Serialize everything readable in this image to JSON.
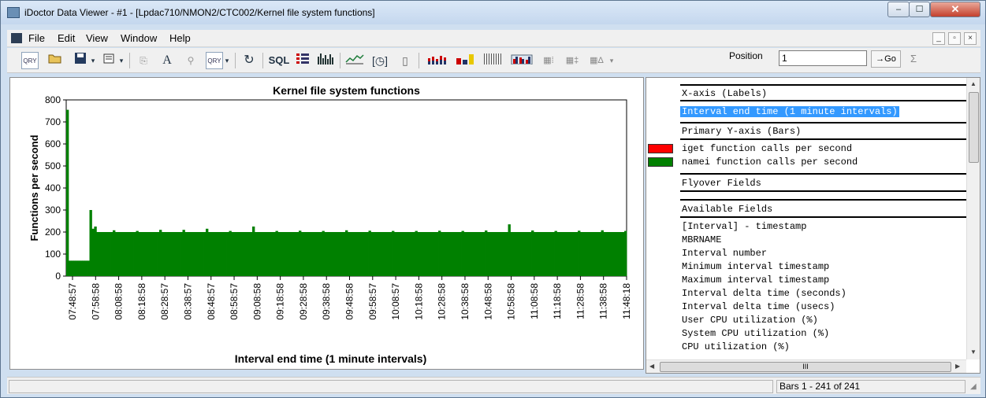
{
  "window": {
    "title": "iDoctor Data Viewer - #1 - [Lpdac710/NMON2/CTC002/Kernel file system functions]",
    "controls": {
      "minimize": "–",
      "maximize": "☐",
      "close": "✕"
    }
  },
  "menu": {
    "items": [
      "File",
      "Edit",
      "View",
      "Window",
      "Help"
    ],
    "mdi_controls": [
      "_",
      "▫",
      "×"
    ]
  },
  "toolbar": {
    "sql_label": "SQL",
    "position_label": "Position",
    "position_value": "1",
    "go_label": "→Go",
    "sum_label": "Σ",
    "icons": [
      "query-icon",
      "open-icon",
      "save-icon",
      "properties-icon",
      "copy-icon",
      "font-icon",
      "filter-icon",
      "query2-icon",
      "refresh-icon",
      "sql-icon",
      "list-icon",
      "bar-chart-icon",
      "line-chart-icon",
      "clock-icon",
      "calendar-icon",
      "stacked-bar-icon",
      "colored-bar-icon",
      "thin-bar-icon",
      "grouped-bar-icon",
      "grid-bar-icon",
      "grid-bar2-icon",
      "delta-bar-icon"
    ]
  },
  "chart_data": {
    "type": "bar",
    "title": "Kernel file system functions",
    "xlabel": "Interval end time (1 minute intervals)",
    "ylabel": "Functions per second",
    "ylim": [
      0,
      800
    ],
    "yticks": [
      0,
      100,
      200,
      300,
      400,
      500,
      600,
      700,
      800
    ],
    "xtick_labels": [
      "07:48:57",
      "07:58:58",
      "08:08:58",
      "08:18:58",
      "08:28:57",
      "08:38:57",
      "08:48:57",
      "08:58:57",
      "09:08:58",
      "09:18:58",
      "09:28:58",
      "09:38:58",
      "09:48:58",
      "09:58:57",
      "10:08:57",
      "10:18:58",
      "10:28:58",
      "10:38:58",
      "10:48:58",
      "10:58:58",
      "11:08:58",
      "11:18:58",
      "11:28:58",
      "11:38:58",
      "11:48:18"
    ],
    "bar_count": 241,
    "series": [
      {
        "name": "namei function calls per second",
        "color": "#008000",
        "baseline": 200,
        "segments": [
          {
            "from": 0,
            "to": 0,
            "value": 755
          },
          {
            "from": 1,
            "to": 9,
            "value": 70
          },
          {
            "from": 10,
            "to": 10,
            "value": 300
          },
          {
            "from": 11,
            "to": 11,
            "value": 215
          },
          {
            "from": 12,
            "to": 12,
            "value": 225
          }
        ],
        "spikes": [
          {
            "index": 20,
            "value": 208
          },
          {
            "index": 30,
            "value": 205
          },
          {
            "index": 40,
            "value": 210
          },
          {
            "index": 50,
            "value": 210
          },
          {
            "index": 60,
            "value": 215
          },
          {
            "index": 70,
            "value": 205
          },
          {
            "index": 80,
            "value": 225
          },
          {
            "index": 90,
            "value": 205
          },
          {
            "index": 100,
            "value": 206
          },
          {
            "index": 110,
            "value": 205
          },
          {
            "index": 120,
            "value": 208
          },
          {
            "index": 130,
            "value": 206
          },
          {
            "index": 140,
            "value": 205
          },
          {
            "index": 150,
            "value": 205
          },
          {
            "index": 160,
            "value": 206
          },
          {
            "index": 170,
            "value": 205
          },
          {
            "index": 180,
            "value": 207
          },
          {
            "index": 190,
            "value": 235
          },
          {
            "index": 200,
            "value": 207
          },
          {
            "index": 210,
            "value": 205
          },
          {
            "index": 220,
            "value": 206
          },
          {
            "index": 230,
            "value": 208
          },
          {
            "index": 240,
            "value": 205
          }
        ]
      }
    ]
  },
  "right_panel": {
    "x_axis_header": "X-axis (Labels)",
    "x_axis_selected": "Interval end time (1 minute intervals)",
    "y_axis_header": "Primary Y-axis (Bars)",
    "legend": [
      {
        "label": "iget function calls per second",
        "color": "#ff0000"
      },
      {
        "label": "namei function calls per second",
        "color": "#008000"
      }
    ],
    "flyover_header": "Flyover Fields",
    "available_header": "Available Fields",
    "available_fields": [
      "[Interval] - timestamp",
      "MBRNAME",
      "Interval number",
      "Minimum interval timestamp",
      "Maximum interval timestamp",
      "Interval delta time (seconds)",
      "Interval delta time (usecs)",
      "User CPU utilization (%)",
      "System CPU utilization (%)",
      "CPU utilization (%)"
    ],
    "hscroll_grip": "III"
  },
  "status": {
    "bars_text": "Bars 1 - 241 of 241"
  }
}
